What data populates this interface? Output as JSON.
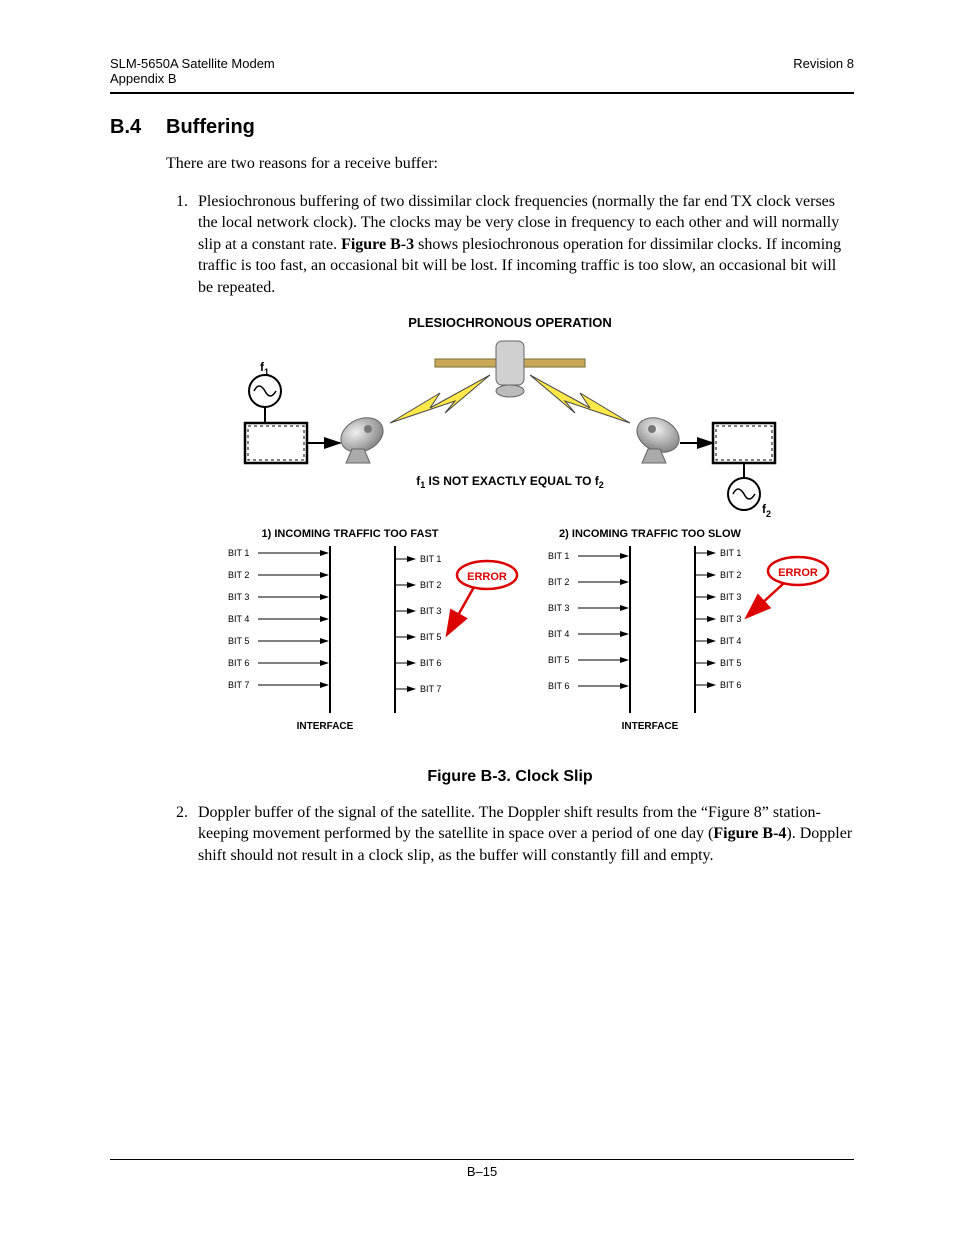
{
  "header": {
    "left_line1": "SLM-5650A Satellite Modem",
    "left_line2": "Appendix B",
    "right_line1": "Revision 8"
  },
  "section": {
    "number": "B.4",
    "title": "Buffering"
  },
  "intro": "There are two reasons for a receive buffer:",
  "items": {
    "one_prefix": "Plesiochronous buffering of two dissimilar clock frequencies (normally the far end TX clock verses the local network clock). The clocks may be very close in frequency to each other and will normally slip at a constant rate. ",
    "one_bold": "Figure B-3",
    "one_suffix": " shows plesiochronous operation for dissimilar clocks. If incoming traffic is too fast, an occasional bit will be lost. If incoming traffic is too slow, an occasional bit will be repeated.",
    "two_prefix": "Doppler buffer of the signal of the satellite. The Doppler shift results from the “Figure 8” station-keeping movement performed by the satellite in space over a period of one day (",
    "two_bold": "Figure B-4",
    "two_suffix": "). Doppler shift should not result in a clock slip, as the buffer will constantly fill and empty."
  },
  "figure": {
    "title": "PLESIOCHRONOUS OPERATION",
    "note_prefix": "f",
    "note_sub1": "1",
    "note_mid": " IS NOT EXACTLY EQUAL TO f",
    "note_sub2": "2",
    "f1_label": "f",
    "f1_sub": "1",
    "f2_label": "f",
    "f2_sub": "2",
    "left_header": "1) INCOMING TRAFFIC TOO FAST",
    "right_header": "2) INCOMING TRAFFIC TOO SLOW",
    "error": "ERROR",
    "interface": "INTERFACE",
    "left_in": [
      "BIT 1",
      "BIT 2",
      "BIT 3",
      "BIT 4",
      "BIT 5",
      "BIT 6",
      "BIT 7"
    ],
    "left_out": [
      "BIT 1",
      "BIT 2",
      "BIT 3",
      "BIT 5",
      "BIT 6",
      "BIT 7"
    ],
    "right_in": [
      "BIT 1",
      "BIT 2",
      "BIT 3",
      "BIT 4",
      "BIT 5",
      "BIT 6"
    ],
    "right_out": [
      "BIT 1",
      "BIT 2",
      "BIT 3",
      "BIT 3",
      "BIT 4",
      "BIT 5",
      "BIT 6"
    ],
    "caption": "Figure B-3. Clock Slip"
  },
  "footer": {
    "page": "B–15"
  }
}
